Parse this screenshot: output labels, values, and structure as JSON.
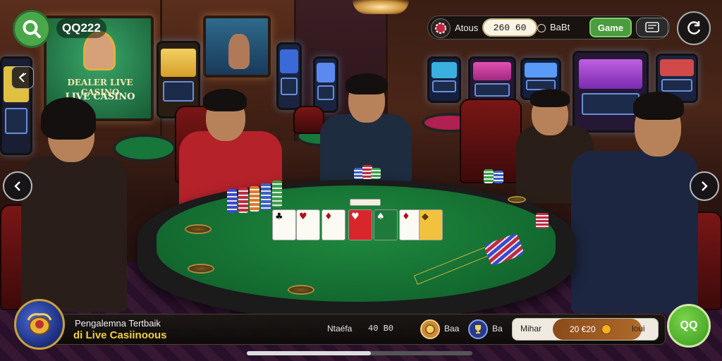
{
  "brand": {
    "title": "QQ222",
    "logo_icon": "search-icon"
  },
  "header": {
    "player_icon": "chip-icon",
    "player_name": "Atous",
    "balance": "260 60",
    "extra_icon": "coin-icon",
    "extra_text": "BaBt",
    "game_button_label": "Game",
    "receipt_icon": "receipt-icon"
  },
  "scene": {
    "screen_title": "DEALER LIVE CASINO",
    "screen_subtitle": "LIVE CASINO"
  },
  "promo": {
    "line1": "Pengalemna Tertbaik",
    "line2": "di Live Casiinoous"
  },
  "bottom": {
    "stat_label": "Ntaéfa",
    "stat_value": "40  B0",
    "coin_value": "Baa",
    "trophy_value": "Ba",
    "bet_label": "Mihar",
    "bet_amount": "20 €20",
    "bet_unit": "loui",
    "go_label": "QQ",
    "progress": 0.55
  },
  "colors": {
    "felt": "#13692f",
    "accent_green": "#4a9c3e",
    "promo_yellow": "#f2d23a"
  }
}
